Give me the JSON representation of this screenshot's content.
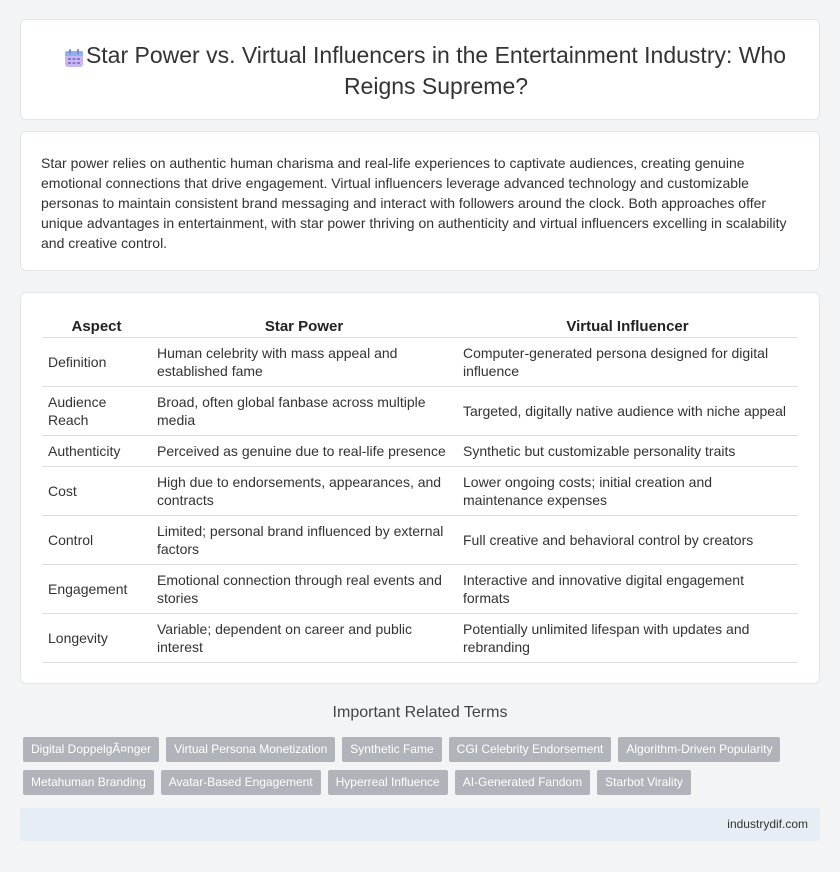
{
  "header": {
    "title": "Star Power vs. Virtual Influencers in the Entertainment Industry: Who Reigns Supreme?",
    "icon": "calendar-icon"
  },
  "intro": {
    "text": "Star power relies on authentic human charisma and real-life experiences to captivate audiences, creating genuine emotional connections that drive engagement. Virtual influencers leverage advanced technology and customizable personas to maintain consistent brand messaging and interact with followers around the clock. Both approaches offer unique advantages in entertainment, with star power thriving on authenticity and virtual influencers excelling in scalability and creative control."
  },
  "table": {
    "headers": [
      "Aspect",
      "Star Power",
      "Virtual Influencer"
    ],
    "rows": [
      {
        "aspect": "Definition",
        "star": "Human celebrity with mass appeal and established fame",
        "virtual": "Computer-generated persona designed for digital influence"
      },
      {
        "aspect": "Audience Reach",
        "star": "Broad, often global fanbase across multiple media",
        "virtual": "Targeted, digitally native audience with niche appeal"
      },
      {
        "aspect": "Authenticity",
        "star": "Perceived as genuine due to real-life presence",
        "virtual": "Synthetic but customizable personality traits"
      },
      {
        "aspect": "Cost",
        "star": "High due to endorsements, appearances, and contracts",
        "virtual": "Lower ongoing costs; initial creation and maintenance expenses"
      },
      {
        "aspect": "Control",
        "star": "Limited; personal brand influenced by external factors",
        "virtual": "Full creative and behavioral control by creators"
      },
      {
        "aspect": "Engagement",
        "star": "Emotional connection through real events and stories",
        "virtual": "Interactive and innovative digital engagement formats"
      },
      {
        "aspect": "Longevity",
        "star": "Variable; dependent on career and public interest",
        "virtual": "Potentially unlimited lifespan with updates and rebranding"
      }
    ]
  },
  "related": {
    "title": "Important Related Terms",
    "row1": [
      "Digital DoppelgÃ¤nger",
      "Virtual Persona Monetization",
      "Synthetic Fame",
      "CGI Celebrity Endorsement",
      "Algorithm-Driven Popularity"
    ],
    "row2": [
      "Metahuman Branding",
      "Avatar-Based Engagement",
      "Hyperreal Influence",
      "AI-Generated Fandom",
      "Starbot Virality"
    ]
  },
  "footer": {
    "site": "industrydif.com"
  }
}
